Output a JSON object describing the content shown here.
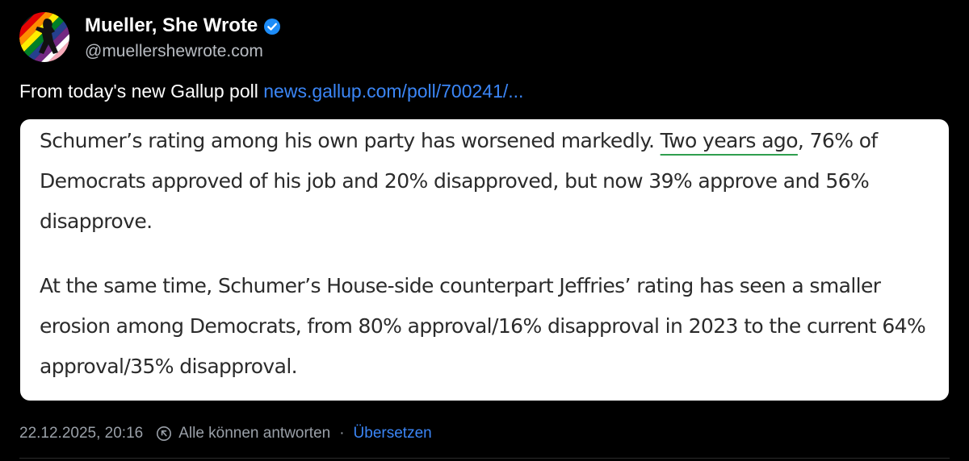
{
  "author": {
    "display_name": "Mueller, She Wrote",
    "handle": "@muellershewrote.com",
    "verified": true
  },
  "post": {
    "text": "From today's new Gallup poll ",
    "link_text": "news.gallup.com/poll/700241/..."
  },
  "embed": {
    "paragraph1_before": "Schumer’s rating among his own party has worsened markedly. ",
    "paragraph1_underlined": "Two years ago",
    "paragraph1_after": ", 76% of Democrats approved of his job and 20% disapproved, but now 39% approve and 56% disapprove.",
    "paragraph2": "At the same time, Schumer’s House-side counterpart Jeffries’ rating has seen a smaller erosion among Democrats, from 80% approval/16% disapproval in 2023 to the current 64% approval/35% disapproval."
  },
  "footer": {
    "timestamp": "22.12.2025, 20:16",
    "reply_setting": "Alle können antworten",
    "separator": "·",
    "translate_label": "Übersetzen"
  },
  "colors": {
    "background": "#000000",
    "link": "#3b86f7",
    "verified_badge": "#1d8cf8",
    "underline": "#2f9e4e",
    "muted_text": "#9aa0a8"
  },
  "icons": {
    "verified": "verified-badge-icon",
    "reply_setting": "reply-setting-icon"
  }
}
